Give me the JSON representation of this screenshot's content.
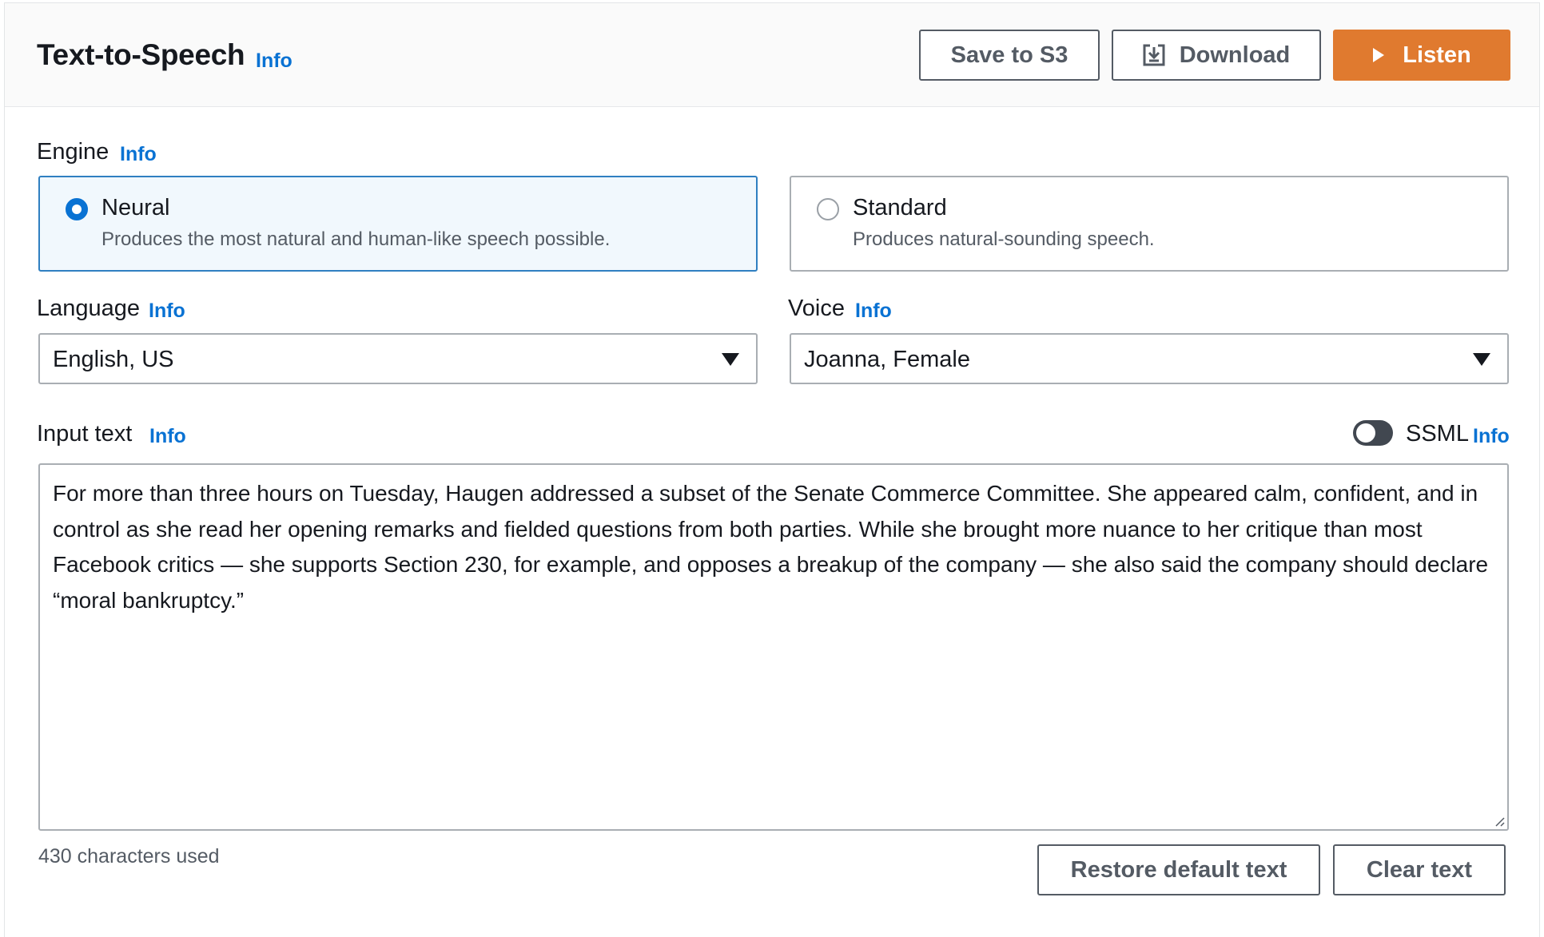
{
  "header": {
    "title": "Text-to-Speech",
    "info": "Info",
    "save_label": "Save to S3",
    "download_label": "Download",
    "listen_label": "Listen",
    "listen_color": "#e07a2f"
  },
  "engine": {
    "label": "Engine",
    "info": "Info",
    "options": [
      {
        "title": "Neural",
        "description": "Produces the most natural and human-like speech possible.",
        "selected": true
      },
      {
        "title": "Standard",
        "description": "Produces natural-sounding speech.",
        "selected": false
      }
    ]
  },
  "language": {
    "label": "Language",
    "info": "Info",
    "value": "English, US"
  },
  "voice": {
    "label": "Voice",
    "info": "Info",
    "value": "Joanna, Female"
  },
  "input": {
    "label": "Input text",
    "info": "Info",
    "ssml_label": "SSML",
    "ssml_info": "Info",
    "ssml_enabled": false,
    "text": "For more than three hours on Tuesday, Haugen addressed a subset of the Senate Commerce Committee. She appeared calm, confident, and in control as she read her opening remarks and fielded questions from both parties. While she brought more nuance to her critique than most Facebook critics — she supports Section 230, for example, and opposes a breakup of the company — she also said the company should declare “moral bankruptcy.”",
    "chars_used": "430 characters used"
  },
  "footer": {
    "restore_label": "Restore default text",
    "clear_label": "Clear text"
  },
  "colors": {
    "link": "#0972d3",
    "selected_border": "#2f7fc1",
    "selected_bg": "#f1f8fd"
  }
}
